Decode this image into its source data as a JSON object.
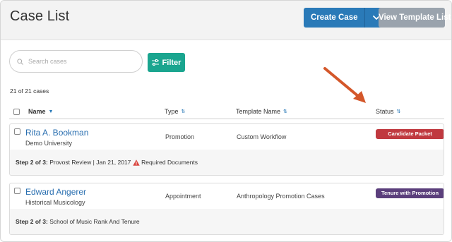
{
  "header": {
    "title": "Case List",
    "create_label": "Create Case",
    "view_template_label": "View Template List"
  },
  "search": {
    "placeholder": "Search cases"
  },
  "filter_label": "Filter",
  "count_text": "21 of 21 cases",
  "columns": {
    "name": "Name",
    "type": "Type",
    "template": "Template Name",
    "status": "Status"
  },
  "cases": [
    {
      "name": "Rita A. Bookman",
      "unit": "Demo University",
      "type": "Promotion",
      "template": "Custom Workflow",
      "status": "Candidate Packet",
      "status_color": "#c0393f",
      "step_bold": "Step 2 of 3:",
      "step_text": "Provost Review",
      "step_sep": "|",
      "step_date": "Jan 21, 2017",
      "step_warning": "Required Documents"
    },
    {
      "name": "Edward Angerer",
      "unit": "Historical Musicology",
      "type": "Appointment",
      "template": "Anthropology Promotion Cases",
      "status": "Tenure with Promotion",
      "status_color": "#5b3f7c",
      "step_bold": "Step 2 of 3:",
      "step_text": "School of Music Rank And Tenure"
    }
  ],
  "colors": {
    "primary": "#2a7ab8",
    "filter": "#1aa58f",
    "muted_button": "#9aa3ad",
    "annotation_arrow": "#d4572a"
  },
  "icons": [
    "chevron-down-icon",
    "search-icon",
    "sliders-icon",
    "warning-icon",
    "sort-icon",
    "annotation-arrow"
  ]
}
